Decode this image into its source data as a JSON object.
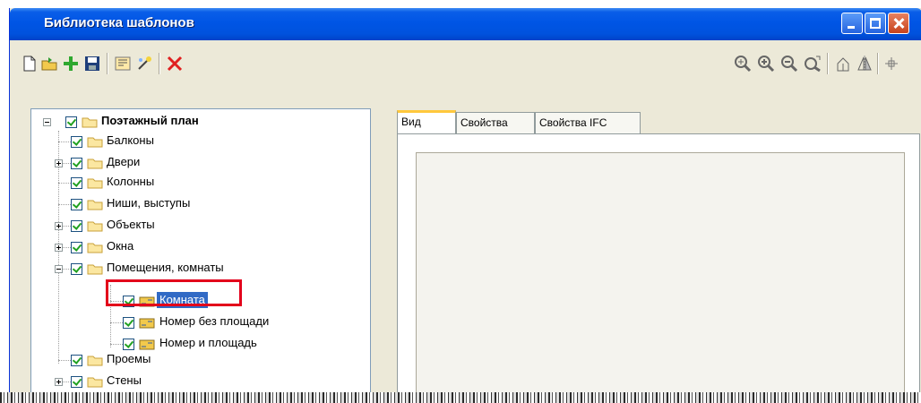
{
  "window": {
    "title": "Библиотека шаблонов"
  },
  "toolbar": {
    "left_icons": [
      "new-icon",
      "open-icon",
      "add-icon",
      "save-icon",
      "template-icon",
      "wand-icon",
      "delete-icon"
    ],
    "right_icons": [
      "zoom-region-icon",
      "zoom-in-icon",
      "zoom-out-icon",
      "zoom-extents-icon",
      "rotate-icon",
      "mirror-icon",
      "crosshair-icon"
    ]
  },
  "tree": {
    "root": "Поэтажный план",
    "items": [
      {
        "label": "Балконы"
      },
      {
        "label": "Двери"
      },
      {
        "label": "Колонны"
      },
      {
        "label": "Ниши, выступы"
      },
      {
        "label": "Объекты"
      },
      {
        "label": "Окна"
      },
      {
        "label": "Помещения, комнаты"
      },
      {
        "label": "Комната"
      },
      {
        "label": "Номер без площади"
      },
      {
        "label": "Номер и площадь"
      },
      {
        "label": "Проемы"
      },
      {
        "label": "Стены"
      }
    ]
  },
  "tabs": [
    {
      "label": "Вид"
    },
    {
      "label": "Свойства"
    },
    {
      "label": "Свойства IFC"
    }
  ],
  "colors": {
    "title_bar": "#0055e5",
    "selection": "#316ac5",
    "highlight_box": "#e3001b",
    "check": "#21a121"
  }
}
